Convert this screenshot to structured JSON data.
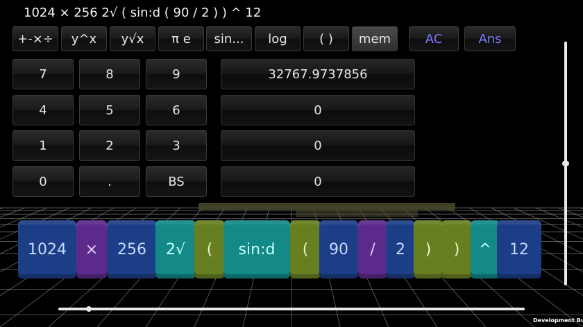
{
  "expression": "1024 × 256 2√ ( sin:d ( 90 / 2 ) ) ^ 12",
  "toolbar": {
    "tabs": [
      {
        "label": "+-×÷"
      },
      {
        "label": "y^x"
      },
      {
        "label": "y√x"
      },
      {
        "label": "π e"
      },
      {
        "label": "sin..."
      },
      {
        "label": "log"
      },
      {
        "label": "( )"
      },
      {
        "label": "mem",
        "active": true
      }
    ],
    "ac_label": "AC",
    "ans_label": "Ans"
  },
  "keypad": {
    "keys": [
      "7",
      "8",
      "9",
      "4",
      "5",
      "6",
      "1",
      "2",
      "3",
      "0",
      ".",
      "BS"
    ]
  },
  "memory": {
    "slots": [
      "32767.9737856",
      "0",
      "0",
      "0"
    ]
  },
  "tokens": [
    {
      "text": "1024",
      "kind": "num"
    },
    {
      "text": "×",
      "kind": "op"
    },
    {
      "text": "256",
      "kind": "num"
    },
    {
      "text": "2√",
      "kind": "fn"
    },
    {
      "text": "(",
      "kind": "par"
    },
    {
      "text": "sin:d",
      "kind": "fn"
    },
    {
      "text": "(",
      "kind": "par"
    },
    {
      "text": "90",
      "kind": "num"
    },
    {
      "text": "/",
      "kind": "op"
    },
    {
      "text": "2",
      "kind": "num"
    },
    {
      "text": ")",
      "kind": "par"
    },
    {
      "text": ")",
      "kind": "par"
    },
    {
      "text": "^",
      "kind": "fn"
    },
    {
      "text": "12",
      "kind": "num"
    }
  ],
  "footer": {
    "build_label": "Development Build"
  },
  "colors": {
    "accent_blue": "#7b7bff",
    "number_token": "#1c3e86",
    "operator_token": "#5c2a8a",
    "function_token": "#138a88",
    "paren_token": "#677f20"
  }
}
